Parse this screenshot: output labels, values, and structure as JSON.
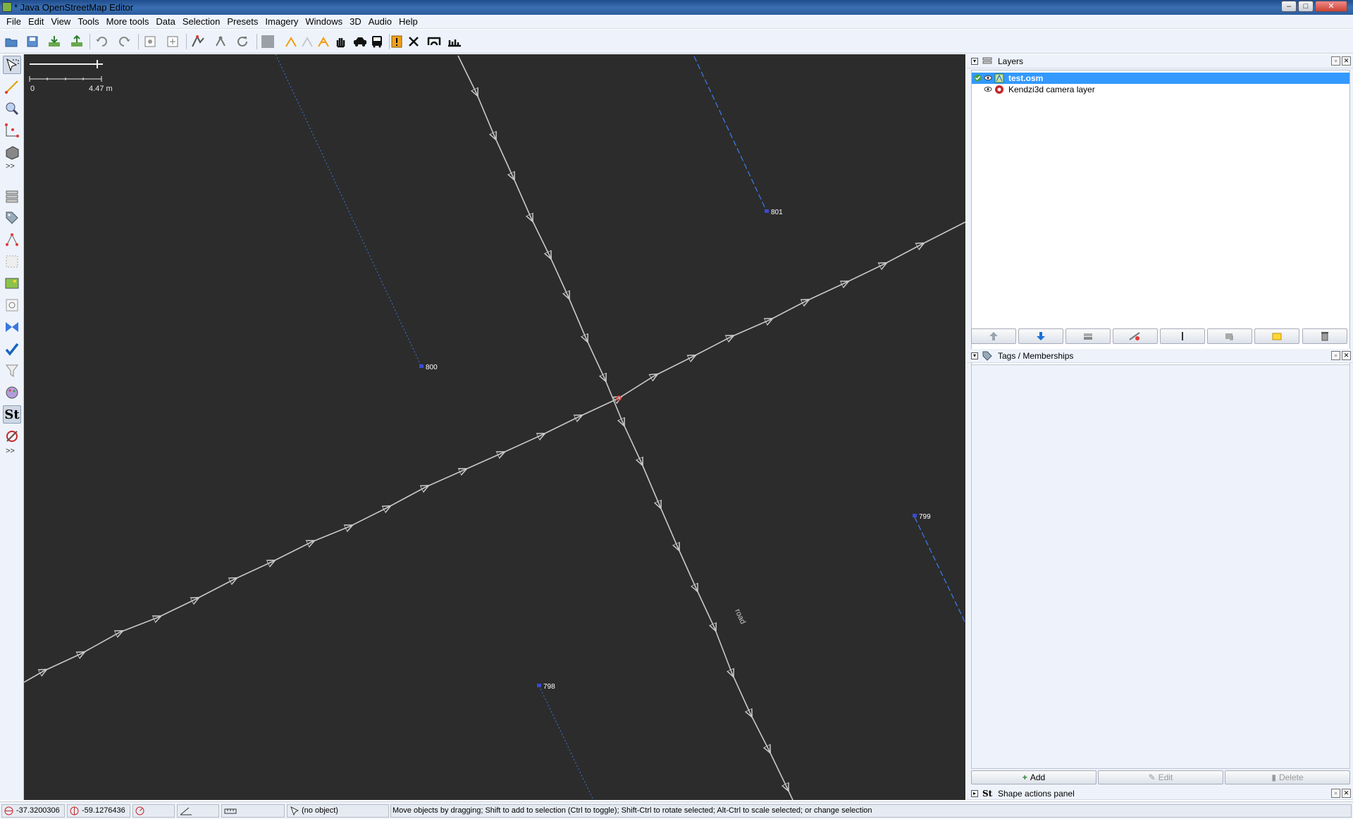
{
  "window": {
    "title": "* Java OpenStreetMap Editor",
    "controls": [
      "–",
      "□",
      "✕"
    ]
  },
  "menu": {
    "items": [
      "File",
      "Edit",
      "View",
      "Tools",
      "More tools",
      "Data",
      "Selection",
      "Presets",
      "Imagery",
      "Windows",
      "3D",
      "Audio",
      "Help"
    ]
  },
  "toolbar": {
    "icons": [
      "open-icon",
      "save-icon",
      "download-icon",
      "upload-icon",
      "undo-icon",
      "redo-icon",
      "preferences-icon",
      "zoom-fit-icon",
      "split-way-icon",
      "merge-nodes-icon",
      "refresh-icon",
      "wms-layer-icon",
      "tool-a-icon",
      "tool-b-icon",
      "tool-c-icon",
      "hand-icon",
      "car-icon",
      "bus-icon",
      "validator-icon",
      "delete-icon",
      "bridge-icon",
      "chart-icon"
    ]
  },
  "left_toolbar": {
    "icons": [
      "select-icon",
      "draw-icon",
      "zoom-icon",
      "improve-way-icon",
      "building-icon",
      "layers-panel-icon",
      "tags-panel-icon",
      "relations-icon",
      "selection-list-icon",
      "imagery-icon",
      "filter-panel-icon",
      "conflict-icon",
      "validation-icon",
      "filter-icon",
      "map-paint-icon",
      "shape-tools-icon",
      "kendzi-icon"
    ],
    "more_label": ">>",
    "shape_label": "St"
  },
  "map": {
    "scale_zero": "0",
    "scale_distance": "4.47 m",
    "road_label": "road",
    "node_labels": [
      "800",
      "801",
      "799",
      "798"
    ]
  },
  "layers_panel": {
    "title": "Layers",
    "layers": [
      {
        "name": "test.osm",
        "selected": true
      },
      {
        "name": "Kendzi3d camera layer",
        "selected": false
      }
    ],
    "buttons": [
      "move-up-icon",
      "move-down-icon",
      "merge-icon",
      "visibility-icon",
      "opacity-icon",
      "duplicate-icon",
      "activate-icon",
      "delete-layer-icon"
    ]
  },
  "tags_panel": {
    "title": "Tags / Memberships",
    "add_label": "Add",
    "edit_label": "Edit",
    "delete_label": "Delete"
  },
  "shape_panel": {
    "title": "Shape actions panel"
  },
  "status": {
    "latitude": "-37.3200306",
    "longitude": "-59.1276436",
    "object": "(no object)",
    "help": "Move objects by dragging; Shift to add to selection (Ctrl to toggle); Shift-Ctrl to rotate selected; Alt-Ctrl to scale selected; or change selection"
  },
  "colors": {
    "map_background": "#2c2c2c",
    "way_line": "#c8c8c8",
    "dashed_line": "#3a78e0",
    "selection": "#3399ff"
  }
}
